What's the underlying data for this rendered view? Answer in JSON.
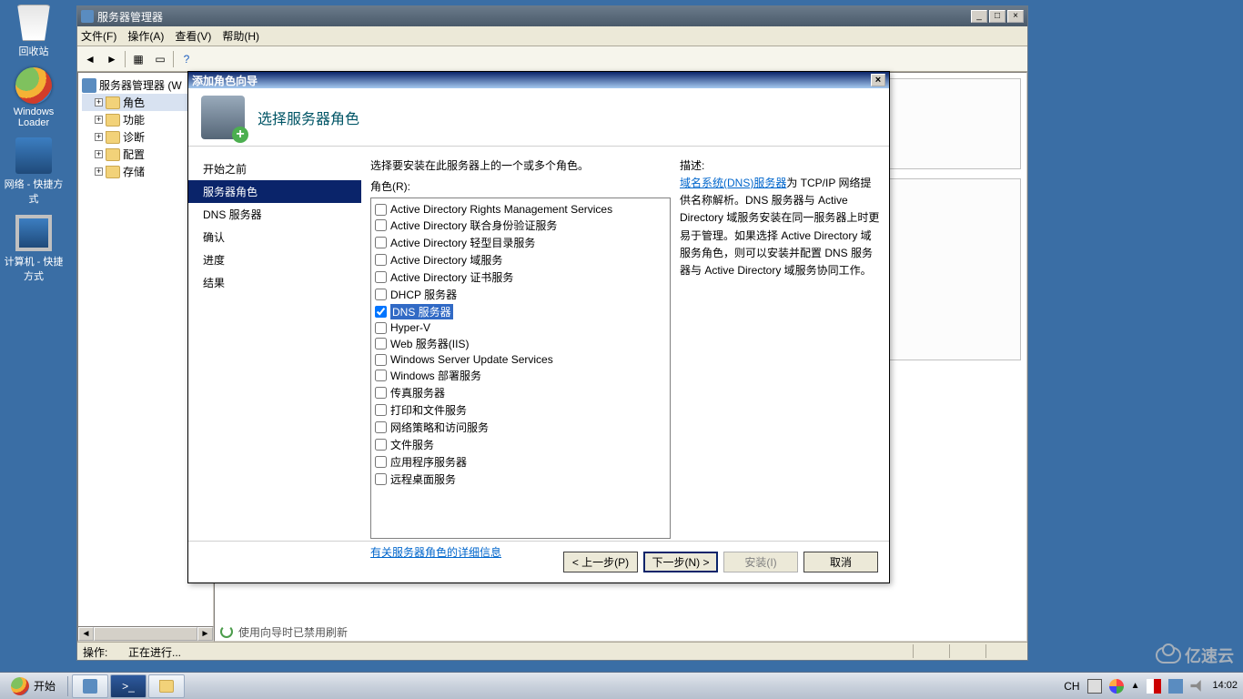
{
  "desktop": {
    "recycle_bin": "回收站",
    "loader": "Windows Loader",
    "network_shortcut": "网络 - 快捷方式",
    "computer_shortcut": "计算机 - 快捷方式"
  },
  "server_manager": {
    "title": "服务器管理器",
    "menu": {
      "file": "文件(F)",
      "action": "操作(A)",
      "view": "查看(V)",
      "help": "帮助(H)"
    },
    "tree": {
      "root": "服务器管理器 (W",
      "roles": "角色",
      "features": "功能",
      "diagnostics": "诊断",
      "configuration": "配置",
      "storage": "存储"
    },
    "refresh_status": "使用向导时已禁用刷新",
    "status_bar": {
      "label": "操作:",
      "value": "正在进行..."
    }
  },
  "wizard": {
    "title": "添加角色向导",
    "heading": "选择服务器角色",
    "steps": {
      "before": "开始之前",
      "roles": "服务器角色",
      "dns": "DNS 服务器",
      "confirm": "确认",
      "progress": "进度",
      "results": "结果"
    },
    "instruction": "选择要安装在此服务器上的一个或多个角色。",
    "roles_label": "角色(R):",
    "roles": [
      {
        "label": "Active Directory Rights Management Services",
        "checked": false
      },
      {
        "label": "Active Directory 联合身份验证服务",
        "checked": false
      },
      {
        "label": "Active Directory 轻型目录服务",
        "checked": false
      },
      {
        "label": "Active Directory 域服务",
        "checked": false
      },
      {
        "label": "Active Directory 证书服务",
        "checked": false
      },
      {
        "label": "DHCP 服务器",
        "checked": false
      },
      {
        "label": "DNS 服务器",
        "checked": true,
        "selected": true
      },
      {
        "label": "Hyper-V",
        "checked": false
      },
      {
        "label": "Web 服务器(IIS)",
        "checked": false
      },
      {
        "label": "Windows Server Update Services",
        "checked": false
      },
      {
        "label": "Windows 部署服务",
        "checked": false
      },
      {
        "label": "传真服务器",
        "checked": false
      },
      {
        "label": "打印和文件服务",
        "checked": false
      },
      {
        "label": "网络策略和访问服务",
        "checked": false
      },
      {
        "label": "文件服务",
        "checked": false
      },
      {
        "label": "应用程序服务器",
        "checked": false
      },
      {
        "label": "远程桌面服务",
        "checked": false
      }
    ],
    "more_info": "有关服务器角色的详细信息",
    "description_label": "描述:",
    "description_link": "域名系统(DNS)服务器",
    "description_text": "为 TCP/IP 网络提供名称解析。DNS 服务器与 Active Directory 域服务安装在同一服务器上时更易于管理。如果选择 Active Directory 域服务角色，则可以安装并配置 DNS 服务器与 Active Directory 域服务协同工作。",
    "buttons": {
      "prev": "< 上一步(P)",
      "next": "下一步(N) >",
      "install": "安装(I)",
      "cancel": "取消"
    }
  },
  "taskbar": {
    "start": "开始",
    "ime": "CH",
    "time": "14:02"
  },
  "watermark": "亿速云"
}
